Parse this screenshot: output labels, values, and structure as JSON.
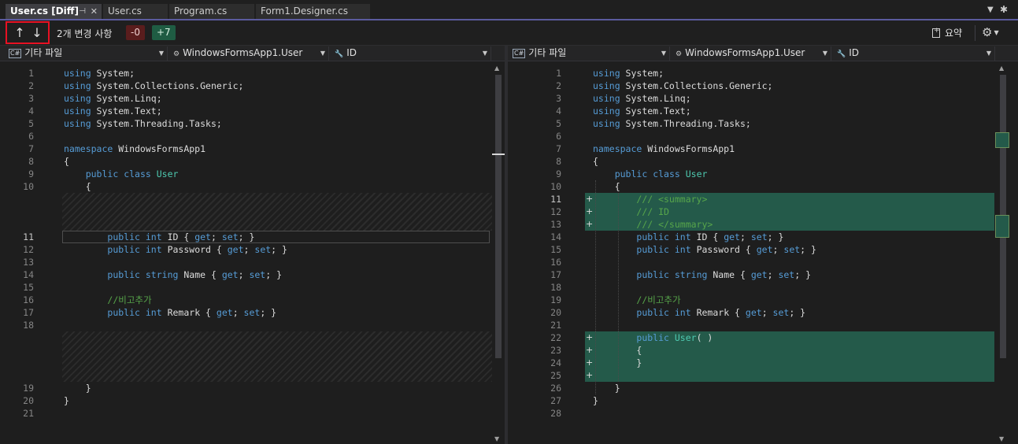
{
  "tabs": [
    {
      "label": "User.cs [Diff]",
      "active": true,
      "pinned": true
    },
    {
      "label": "User.cs",
      "active": false
    },
    {
      "label": "Program.cs",
      "active": false
    },
    {
      "label": "Form1.Designer.cs",
      "active": false
    }
  ],
  "toolbar": {
    "up_arrow": "↑",
    "down_arrow": "↓",
    "change_count": "2개 변경 사항",
    "removed": "-0",
    "added": "+7",
    "summary": "요약"
  },
  "colors": {
    "accent": "#5b5b9e",
    "added": "#245a4a",
    "removed": "#5a1d1d",
    "keyword": "#569cd6",
    "type": "#4ec9b0",
    "comment": "#57a64a"
  },
  "left": {
    "nav": {
      "project": "기타 파일",
      "type": "WindowsFormsApp1.User",
      "member": "ID"
    },
    "lines": [
      {
        "n": "1",
        "code": [
          [
            "k",
            "using"
          ],
          [
            "p",
            " System;"
          ]
        ]
      },
      {
        "n": "2",
        "code": [
          [
            "k",
            "using"
          ],
          [
            "p",
            " System.Collections.Generic;"
          ]
        ]
      },
      {
        "n": "3",
        "code": [
          [
            "k",
            "using"
          ],
          [
            "p",
            " System.Linq;"
          ]
        ]
      },
      {
        "n": "4",
        "code": [
          [
            "k",
            "using"
          ],
          [
            "p",
            " System.Text;"
          ]
        ]
      },
      {
        "n": "5",
        "code": [
          [
            "k",
            "using"
          ],
          [
            "p",
            " System.Threading.Tasks;"
          ]
        ]
      },
      {
        "n": "6",
        "code": []
      },
      {
        "n": "7",
        "code": [
          [
            "k",
            "namespace"
          ],
          [
            "p",
            " WindowsFormsApp1"
          ]
        ]
      },
      {
        "n": "8",
        "code": [
          [
            "p",
            "{"
          ]
        ]
      },
      {
        "n": "9",
        "code": [
          [
            "p",
            "    "
          ],
          [
            "k",
            "public"
          ],
          [
            "p",
            " "
          ],
          [
            "k",
            "class"
          ],
          [
            "p",
            " "
          ],
          [
            "t",
            "User"
          ]
        ]
      },
      {
        "n": "10",
        "code": [
          [
            "p",
            "    {"
          ]
        ]
      },
      {
        "gap": true
      },
      {
        "gap": true
      },
      {
        "gap": true
      },
      {
        "n": "11",
        "current": true,
        "code": [
          [
            "p",
            "        "
          ],
          [
            "k",
            "public"
          ],
          [
            "p",
            " "
          ],
          [
            "k",
            "int"
          ],
          [
            "p",
            " ID { "
          ],
          [
            "k",
            "get"
          ],
          [
            "p",
            "; "
          ],
          [
            "k",
            "set"
          ],
          [
            "p",
            "; }"
          ]
        ]
      },
      {
        "n": "12",
        "code": [
          [
            "p",
            "        "
          ],
          [
            "k",
            "public"
          ],
          [
            "p",
            " "
          ],
          [
            "k",
            "int"
          ],
          [
            "p",
            " Password { "
          ],
          [
            "k",
            "get"
          ],
          [
            "p",
            "; "
          ],
          [
            "k",
            "set"
          ],
          [
            "p",
            "; }"
          ]
        ]
      },
      {
        "n": "13",
        "code": []
      },
      {
        "n": "14",
        "code": [
          [
            "p",
            "        "
          ],
          [
            "k",
            "public"
          ],
          [
            "p",
            " "
          ],
          [
            "k",
            "string"
          ],
          [
            "p",
            " Name { "
          ],
          [
            "k",
            "get"
          ],
          [
            "p",
            "; "
          ],
          [
            "k",
            "set"
          ],
          [
            "p",
            "; }"
          ]
        ]
      },
      {
        "n": "15",
        "code": []
      },
      {
        "n": "16",
        "code": [
          [
            "p",
            "        "
          ],
          [
            "c",
            "//비고추가"
          ]
        ]
      },
      {
        "n": "17",
        "code": [
          [
            "p",
            "        "
          ],
          [
            "k",
            "public"
          ],
          [
            "p",
            " "
          ],
          [
            "k",
            "int"
          ],
          [
            "p",
            " Remark { "
          ],
          [
            "k",
            "get"
          ],
          [
            "p",
            "; "
          ],
          [
            "k",
            "set"
          ],
          [
            "p",
            "; }"
          ]
        ]
      },
      {
        "n": "18",
        "code": []
      },
      {
        "gap": true
      },
      {
        "gap": true
      },
      {
        "gap": true
      },
      {
        "gap": true
      },
      {
        "n": "19",
        "code": [
          [
            "p",
            "    }"
          ]
        ]
      },
      {
        "n": "20",
        "code": [
          [
            "p",
            "}"
          ]
        ]
      },
      {
        "n": "21",
        "code": []
      }
    ]
  },
  "right": {
    "nav": {
      "project": "기타 파일",
      "type": "WindowsFormsApp1.User",
      "member": "ID"
    },
    "lines": [
      {
        "n": "1",
        "code": [
          [
            "k",
            "using"
          ],
          [
            "p",
            " System;"
          ]
        ]
      },
      {
        "n": "2",
        "code": [
          [
            "k",
            "using"
          ],
          [
            "p",
            " System.Collections.Generic;"
          ]
        ]
      },
      {
        "n": "3",
        "code": [
          [
            "k",
            "using"
          ],
          [
            "p",
            " System.Linq;"
          ]
        ]
      },
      {
        "n": "4",
        "code": [
          [
            "k",
            "using"
          ],
          [
            "p",
            " System.Text;"
          ]
        ]
      },
      {
        "n": "5",
        "code": [
          [
            "k",
            "using"
          ],
          [
            "p",
            " System.Threading.Tasks;"
          ]
        ]
      },
      {
        "n": "6",
        "code": []
      },
      {
        "n": "7",
        "code": [
          [
            "k",
            "namespace"
          ],
          [
            "p",
            " WindowsFormsApp1"
          ]
        ]
      },
      {
        "n": "8",
        "code": [
          [
            "p",
            "{"
          ]
        ]
      },
      {
        "n": "9",
        "code": [
          [
            "p",
            "    "
          ],
          [
            "k",
            "public"
          ],
          [
            "p",
            " "
          ],
          [
            "k",
            "class"
          ],
          [
            "p",
            " "
          ],
          [
            "t",
            "User"
          ]
        ]
      },
      {
        "n": "10",
        "code": [
          [
            "p",
            "    {"
          ]
        ]
      },
      {
        "n": "11",
        "added": true,
        "current": true,
        "code": [
          [
            "p",
            "        "
          ],
          [
            "c",
            "/// <summary>"
          ]
        ]
      },
      {
        "n": "12",
        "added": true,
        "code": [
          [
            "p",
            "        "
          ],
          [
            "c",
            "/// ID"
          ]
        ]
      },
      {
        "n": "13",
        "added": true,
        "code": [
          [
            "p",
            "        "
          ],
          [
            "c",
            "/// </summary>"
          ]
        ]
      },
      {
        "n": "14",
        "code": [
          [
            "p",
            "        "
          ],
          [
            "k",
            "public"
          ],
          [
            "p",
            " "
          ],
          [
            "k",
            "int"
          ],
          [
            "p",
            " ID { "
          ],
          [
            "k",
            "get"
          ],
          [
            "p",
            "; "
          ],
          [
            "k",
            "set"
          ],
          [
            "p",
            "; }"
          ]
        ]
      },
      {
        "n": "15",
        "code": [
          [
            "p",
            "        "
          ],
          [
            "k",
            "public"
          ],
          [
            "p",
            " "
          ],
          [
            "k",
            "int"
          ],
          [
            "p",
            " Password { "
          ],
          [
            "k",
            "get"
          ],
          [
            "p",
            "; "
          ],
          [
            "k",
            "set"
          ],
          [
            "p",
            "; }"
          ]
        ]
      },
      {
        "n": "16",
        "code": []
      },
      {
        "n": "17",
        "code": [
          [
            "p",
            "        "
          ],
          [
            "k",
            "public"
          ],
          [
            "p",
            " "
          ],
          [
            "k",
            "string"
          ],
          [
            "p",
            " Name { "
          ],
          [
            "k",
            "get"
          ],
          [
            "p",
            "; "
          ],
          [
            "k",
            "set"
          ],
          [
            "p",
            "; }"
          ]
        ]
      },
      {
        "n": "18",
        "code": []
      },
      {
        "n": "19",
        "code": [
          [
            "p",
            "        "
          ],
          [
            "c",
            "//비고추가"
          ]
        ]
      },
      {
        "n": "20",
        "code": [
          [
            "p",
            "        "
          ],
          [
            "k",
            "public"
          ],
          [
            "p",
            " "
          ],
          [
            "k",
            "int"
          ],
          [
            "p",
            " Remark { "
          ],
          [
            "k",
            "get"
          ],
          [
            "p",
            "; "
          ],
          [
            "k",
            "set"
          ],
          [
            "p",
            "; }"
          ]
        ]
      },
      {
        "n": "21",
        "code": []
      },
      {
        "n": "22",
        "added": true,
        "code": [
          [
            "p",
            "        "
          ],
          [
            "k",
            "public"
          ],
          [
            "p",
            " "
          ],
          [
            "t",
            "User"
          ],
          [
            "p",
            "( )"
          ]
        ]
      },
      {
        "n": "23",
        "added": true,
        "code": [
          [
            "p",
            "        {"
          ]
        ]
      },
      {
        "n": "24",
        "added": true,
        "code": [
          [
            "p",
            "        }"
          ]
        ]
      },
      {
        "n": "25",
        "added": true,
        "code": []
      },
      {
        "n": "26",
        "code": [
          [
            "p",
            "    }"
          ]
        ]
      },
      {
        "n": "27",
        "code": [
          [
            "p",
            "}"
          ]
        ]
      },
      {
        "n": "28",
        "code": []
      }
    ]
  }
}
